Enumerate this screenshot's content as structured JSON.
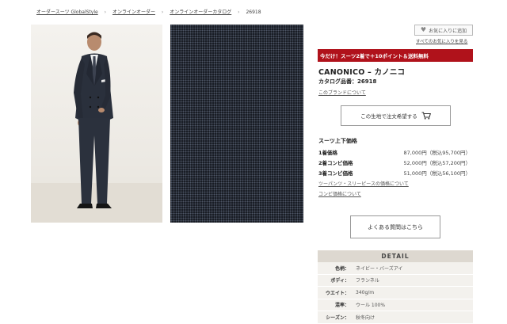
{
  "breadcrumb": {
    "items": [
      "オーダースーツ GlobalStyle",
      "オンラインオーダー",
      "オンラインオーダーカタログ",
      "26918"
    ]
  },
  "favorites": {
    "add_label": "お気に入りに追加",
    "list_label": "すべてのお気に入りを見る"
  },
  "promo": {
    "text": "今だけ！スーツ2着で＋10ポイント＆送料無料",
    "color": "#b0121b"
  },
  "product": {
    "title": "CANONICO – カノニコ",
    "catalog_no": "カタログ品番：26918",
    "brand_link": "このブランドについて",
    "order_button": "この生地で注文希望する"
  },
  "pricing": {
    "heading": "スーツ上下価格",
    "rows": [
      {
        "label": "1着価格",
        "value": "87,000円（税込95,700円）"
      },
      {
        "label": "2着コンビ価格",
        "value": "52,000円（税込57,200円）"
      },
      {
        "label": "3着コンビ価格",
        "value": "51,000円（税込56,100円）"
      }
    ],
    "link_pants": "ツーパンツ・スリーピースの価格について",
    "link_combo": "コンビ価格について"
  },
  "faq_button": "よくある質問はこちら",
  "detail": {
    "heading": "DETAIL",
    "rows": [
      {
        "key": "色柄：",
        "value": "ネイビー・バーズアイ"
      },
      {
        "key": "ボディ：",
        "value": "フランネル"
      },
      {
        "key": "ウエイト：",
        "value": "340g/m"
      },
      {
        "key": "混率：",
        "value": "ウール 100%"
      },
      {
        "key": "シーズン：",
        "value": "秋冬向け"
      }
    ]
  }
}
